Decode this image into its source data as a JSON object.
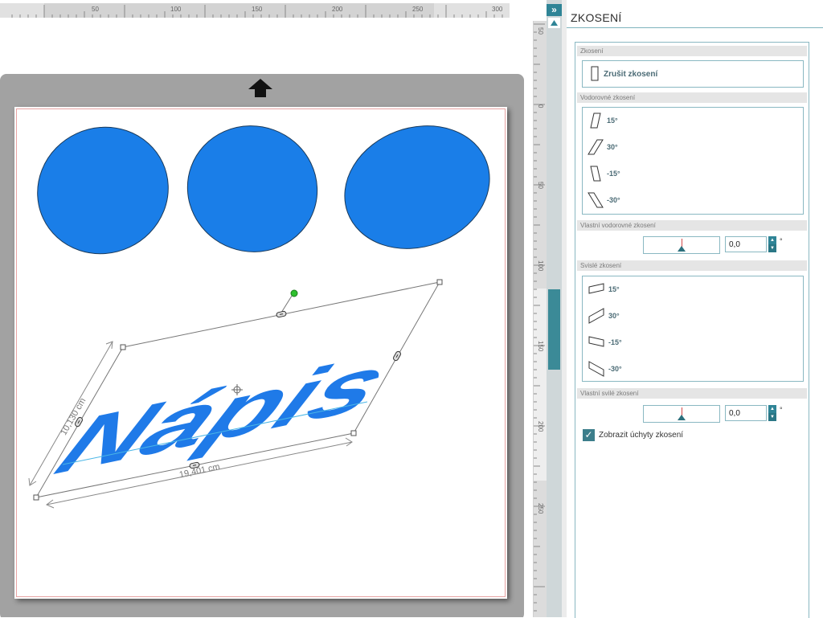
{
  "panel": {
    "title": "ZKOSENÍ",
    "collapse_icon": "double-chevron-right-icon",
    "sections": {
      "skew": "Zkosení",
      "horizontal": "Vodorovné zkosení",
      "custom_horizontal": "Vlastní vodorovné zkosení",
      "vertical": "Svislé zkosení",
      "custom_vertical": "Vlastní svilé zkosení"
    },
    "reset_label": "Zrušit zkosení",
    "horizontal_items": [
      "15°",
      "30°",
      "-15°",
      "-30°"
    ],
    "vertical_items": [
      "15°",
      "30°",
      "-15°",
      "-30°"
    ],
    "custom_horizontal_value": "0,0",
    "custom_vertical_value": "0,0",
    "degree_unit": "°",
    "show_handles_label": "Zobrazit úchyty zkosení",
    "show_handles_checked": true
  },
  "rulers": {
    "top": [
      "50",
      "100",
      "150",
      "200",
      "250",
      "300"
    ],
    "side": [
      "50",
      "0",
      "50",
      "100",
      "150",
      "200",
      "250"
    ]
  },
  "canvas": {
    "text_object": "Nápis",
    "width_dimension": "19,401 cm",
    "height_dimension": "10,130 cm"
  },
  "colors": {
    "accent": "#2f8496",
    "shape_fill": "#1a7ee8",
    "text_fill": "#1f7ae8",
    "rotate_handle": "#2ec02e"
  }
}
